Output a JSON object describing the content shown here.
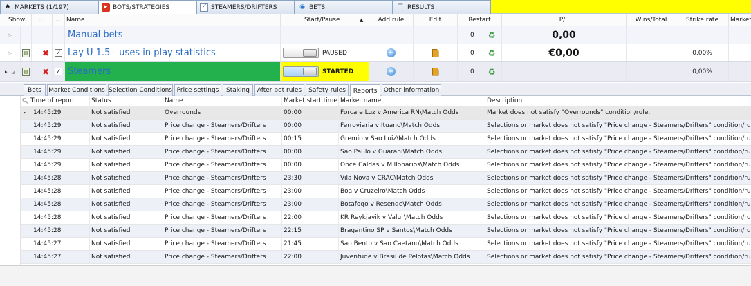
{
  "top_tabs": [
    {
      "label": "MARKETS (1/197)",
      "icon": "markets-icon"
    },
    {
      "label": "BOTS/STRATEGIES",
      "icon": "bots-icon"
    },
    {
      "label": "STEAMERS/DRIFTERS",
      "icon": "chart-icon"
    },
    {
      "label": "BETS",
      "icon": "bets-icon"
    },
    {
      "label": "RESULTS",
      "icon": "results-icon"
    }
  ],
  "grid_headers": {
    "show": "Show",
    "ellipsis1": "...",
    "ellipsis2": "...",
    "name": "Name",
    "start_pause": "Start/Pause",
    "add_rule": "Add rule",
    "edit": "Edit",
    "restart": "Restart",
    "pl": "P/L",
    "wins_total": "Wins/Total",
    "strike_rate": "Strike rate",
    "market": "Market"
  },
  "strategies": [
    {
      "name": "Manual bets",
      "pl": "0,00",
      "restart_count": "0",
      "strike_rate": "",
      "status": ""
    },
    {
      "name": "Lay U 1.5 - uses in play statistics",
      "pl": "€0,00",
      "restart_count": "0",
      "strike_rate": "0,00%",
      "status": "PAUSED"
    },
    {
      "name": "Steamers",
      "pl": "",
      "restart_count": "0",
      "strike_rate": "0,00%",
      "status": "STARTED"
    }
  ],
  "sub_tabs": [
    "Bets",
    "Market Conditions",
    "Selection Conditions",
    "Price settings",
    "Staking",
    "After bet rules",
    "Safety rules",
    "Reports",
    "Other information"
  ],
  "active_sub_tab": "Reports",
  "log_headers": {
    "time": "Time of report",
    "status": "Status",
    "name": "Name",
    "start": "Market start time",
    "market": "Market name",
    "desc": "Description"
  },
  "log_rows": [
    {
      "time": "14:45:29",
      "status": "Not satisfied",
      "name": "Overrounds",
      "start": "00:00",
      "market": "Forca e Luz v America RN\\Match Odds",
      "desc": "Market does not satisfy \"Overrounds\" condition/rule."
    },
    {
      "time": "14:45:29",
      "status": "Not satisfied",
      "name": "Price change - Steamers/Drifters",
      "start": "00:00",
      "market": "Ferroviaria v Ituano\\Match Odds",
      "desc": "Selections or market does not satisfy \"Price change - Steamers/Drifters\" condition/rule."
    },
    {
      "time": "14:45:29",
      "status": "Not satisfied",
      "name": "Price change - Steamers/Drifters",
      "start": "00:15",
      "market": "Gremio v Sao Luiz\\Match Odds",
      "desc": "Selections or market does not satisfy \"Price change - Steamers/Drifters\" condition/rule."
    },
    {
      "time": "14:45:29",
      "status": "Not satisfied",
      "name": "Price change - Steamers/Drifters",
      "start": "00:00",
      "market": "Sao Paulo v Guarani\\Match Odds",
      "desc": "Selections or market does not satisfy \"Price change - Steamers/Drifters\" condition/rule."
    },
    {
      "time": "14:45:29",
      "status": "Not satisfied",
      "name": "Price change - Steamers/Drifters",
      "start": "00:00",
      "market": "Once Caldas v Millonarios\\Match Odds",
      "desc": "Selections or market does not satisfy \"Price change - Steamers/Drifters\" condition/rule."
    },
    {
      "time": "14:45:28",
      "status": "Not satisfied",
      "name": "Price change - Steamers/Drifters",
      "start": "23:30",
      "market": "Vila Nova v CRAC\\Match Odds",
      "desc": "Selections or market does not satisfy \"Price change - Steamers/Drifters\" condition/rule."
    },
    {
      "time": "14:45:28",
      "status": "Not satisfied",
      "name": "Price change - Steamers/Drifters",
      "start": "23:00",
      "market": "Boa v Cruzeiro\\Match Odds",
      "desc": "Selections or market does not satisfy \"Price change - Steamers/Drifters\" condition/rule."
    },
    {
      "time": "14:45:28",
      "status": "Not satisfied",
      "name": "Price change - Steamers/Drifters",
      "start": "23:00",
      "market": "Botafogo v Resende\\Match Odds",
      "desc": "Selections or market does not satisfy \"Price change - Steamers/Drifters\" condition/rule."
    },
    {
      "time": "14:45:28",
      "status": "Not satisfied",
      "name": "Price change - Steamers/Drifters",
      "start": "22:00",
      "market": "KR Reykjavik v Valur\\Match Odds",
      "desc": "Selections or market does not satisfy \"Price change - Steamers/Drifters\" condition/rule."
    },
    {
      "time": "14:45:28",
      "status": "Not satisfied",
      "name": "Price change - Steamers/Drifters",
      "start": "22:15",
      "market": "Bragantino SP v Santos\\Match Odds",
      "desc": "Selections or market does not satisfy \"Price change - Steamers/Drifters\" condition/rule."
    },
    {
      "time": "14:45:27",
      "status": "Not satisfied",
      "name": "Price change - Steamers/Drifters",
      "start": "21:45",
      "market": "Sao Bento v Sao Caetano\\Match Odds",
      "desc": "Selections or market does not satisfy \"Price change - Steamers/Drifters\" condition/rule."
    },
    {
      "time": "14:45:27",
      "status": "Not satisfied",
      "name": "Price change - Steamers/Drifters",
      "start": "22:00",
      "market": "Juventude v Brasil de Pelotas\\Match Odds",
      "desc": "Selections or market does not satisfy \"Price change - Steamers/Drifters\" condition/rule."
    }
  ],
  "colors": {
    "topbar_bg": "#ffff00",
    "steamers_name_bg": "#22b14c",
    "started_bg": "#ffff00",
    "name_text": "#2a6cc7"
  }
}
